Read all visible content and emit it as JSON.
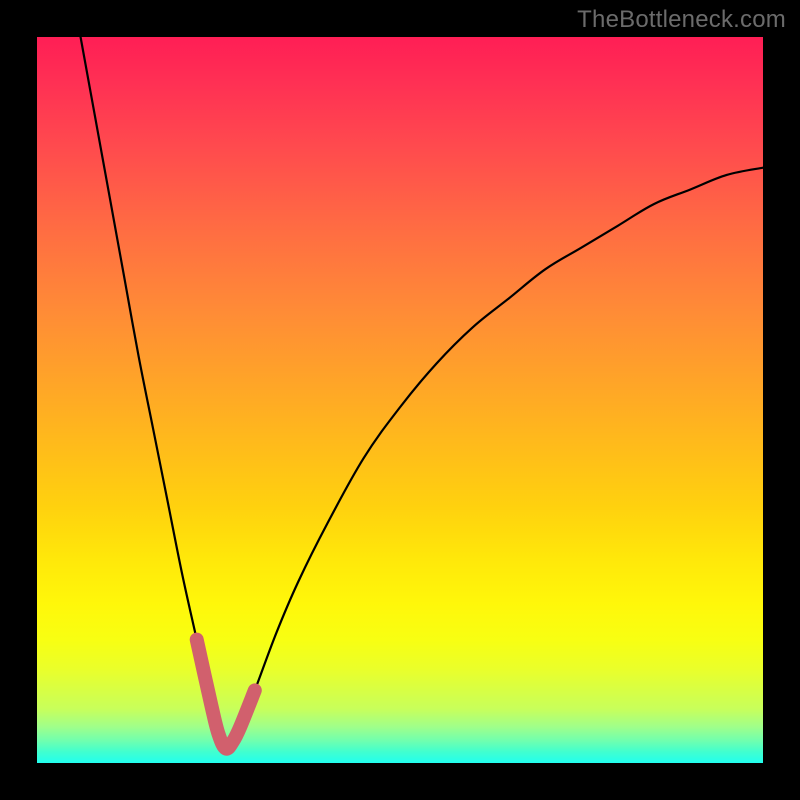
{
  "watermark": "TheBottleneck.com",
  "colors": {
    "frame": "#000000",
    "curve_main": "#000000",
    "curve_highlight": "#d1606d",
    "gradient_stops": [
      "#ff1e55",
      "#ff2f54",
      "#ff4a4e",
      "#ff6b43",
      "#ff8c36",
      "#ffb021",
      "#ffd20e",
      "#ffe80a",
      "#fff70a",
      "#f8ff12",
      "#eaff2a",
      "#c8ff5a",
      "#a0ff8a",
      "#6effb0",
      "#40ffd0",
      "#22ffef"
    ]
  },
  "chart_data": {
    "type": "line",
    "title": "",
    "xlabel": "",
    "ylabel": "",
    "xlim": [
      0,
      100
    ],
    "ylim": [
      0,
      100
    ],
    "x_optimum": 26,
    "series": [
      {
        "name": "bottleneck-curve",
        "x": [
          6,
          8,
          10,
          12,
          14,
          16,
          18,
          20,
          22,
          24,
          25,
          26,
          27,
          28,
          30,
          33,
          36,
          40,
          45,
          50,
          55,
          60,
          65,
          70,
          75,
          80,
          85,
          90,
          95,
          100
        ],
        "y": [
          100,
          89,
          78,
          67,
          56,
          46,
          36,
          26,
          17,
          8,
          4,
          2,
          3,
          5,
          10,
          18,
          25,
          33,
          42,
          49,
          55,
          60,
          64,
          68,
          71,
          74,
          77,
          79,
          81,
          82
        ]
      }
    ],
    "highlight_range_x": [
      22,
      30
    ],
    "annotations": []
  }
}
